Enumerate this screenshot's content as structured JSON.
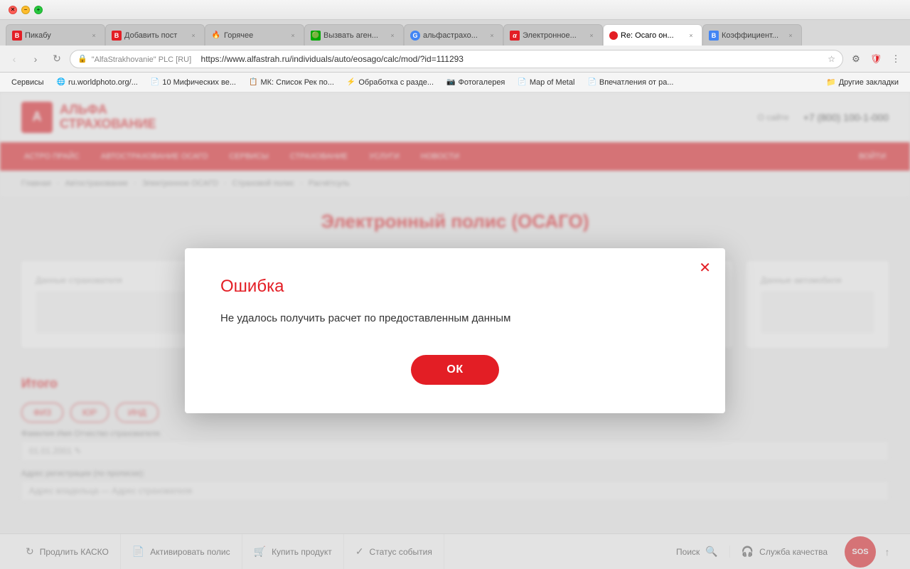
{
  "window": {
    "title": "Re: Осаго он..."
  },
  "tabs": [
    {
      "id": "tab-pikabo",
      "favicon": "🅱",
      "favicon_color": "#e31e25",
      "title": "Пикабу",
      "active": false
    },
    {
      "id": "tab-addpost",
      "favicon": "🅱",
      "favicon_color": "#e31e25",
      "title": "Добавить пост",
      "active": false
    },
    {
      "id": "tab-hot",
      "favicon": "🔥",
      "favicon_color": "#ff6600",
      "title": "Горячее",
      "active": false
    },
    {
      "id": "tab-agent",
      "favicon": "🟢",
      "favicon_color": "#00aa00",
      "title": "Вызвать аген...",
      "active": false
    },
    {
      "id": "tab-alfa",
      "favicon": "G",
      "favicon_color": "#4285f4",
      "title": "альфастрахо...",
      "active": false
    },
    {
      "id": "tab-electronic",
      "favicon": "α",
      "favicon_color": "#e31e25",
      "title": "Электронное...",
      "active": false
    },
    {
      "id": "tab-re-osago",
      "favicon": "🔴",
      "favicon_color": "#e31e25",
      "title": "Re: Осаго он...",
      "active": true
    },
    {
      "id": "tab-koeff",
      "favicon": "B",
      "favicon_color": "#4285f4",
      "title": "Коэффициент...",
      "active": false
    }
  ],
  "address_bar": {
    "url": "https://www.alfastrah.ru/individuals/auto/eosago/calc/mod/?id=111293",
    "site_label": "\"AlfaStrakhovanie\" PLC [RU]"
  },
  "bookmarks": [
    {
      "id": "bm-services",
      "label": "Сервисы"
    },
    {
      "id": "bm-worldphoto",
      "favicon": "🌐",
      "label": "ru.worldphoto.org/..."
    },
    {
      "id": "bm-10myths",
      "favicon": "📄",
      "label": "10 Мифических ве..."
    },
    {
      "id": "bm-mk",
      "favicon": "📋",
      "label": "МК: Список Рек по..."
    },
    {
      "id": "bm-obrabotka",
      "favicon": "⚡",
      "label": "Обработка с разде..."
    },
    {
      "id": "bm-fotogalereya",
      "favicon": "📷",
      "label": "Фотогалерея"
    },
    {
      "id": "bm-mapofmetal",
      "favicon": "📄",
      "label": "Map of Metal"
    },
    {
      "id": "bm-vpechatleniya",
      "favicon": "📄",
      "label": "Впечатления от ра..."
    },
    {
      "id": "bm-folder",
      "label": "Другие закладки"
    }
  ],
  "site": {
    "logo_letter": "А",
    "logo_text_line1": "АЛЬФА",
    "logo_text_line2": "СТРАХОВАНИЕ",
    "header_link": "О сайте",
    "phone": "+7 (800) 100-1-000",
    "nav_items": [
      "АСТРО ПРАЙС",
      "АВТОСТРАХОВАНИЕ ОСАГО",
      "СЕРВИСЫ",
      "СТРАХОВАНИЕ",
      "УСЛУГИ",
      "НОВОСТИ",
      "ВОЙТИ"
    ],
    "breadcrumbs": [
      "Главная",
      "Автострахование",
      "Электронное ОСАГО",
      "Страховой полис",
      "Расчётсуль"
    ],
    "page_title": "Электронный полис (ОСАГО)",
    "blurred_label1": "Данные страхователя",
    "blurred_label2": "Данные автомобиля",
    "form_section_title": "Итого",
    "radio_options": [
      "ФИЗ",
      "ЮР",
      "ИНД"
    ],
    "form_fields": [
      {
        "label": "Фамилия Имя Отчество страхователя:",
        "value": "01.01.2001  ✎"
      },
      {
        "label": "Адрес регистрации (по прописке):",
        "value": "Адрес владельца — Адрес страхователя"
      }
    ]
  },
  "modal": {
    "title": "Ошибка",
    "message": "Не удалось получить расчет по предоставленным данным",
    "ok_label": "ОК"
  },
  "status_bar": {
    "items": [
      {
        "id": "renew-kasko",
        "icon": "↻",
        "label": "Продлить КАСКО"
      },
      {
        "id": "activate-policy",
        "icon": "📄",
        "label": "Активировать полис"
      },
      {
        "id": "buy-product",
        "icon": "🛒",
        "label": "Купить продукт"
      },
      {
        "id": "event-status",
        "icon": "✓",
        "label": "Статус события"
      }
    ],
    "search_label": "Поиск",
    "service_quality": "Служба качества",
    "sos_label": "SOS"
  }
}
